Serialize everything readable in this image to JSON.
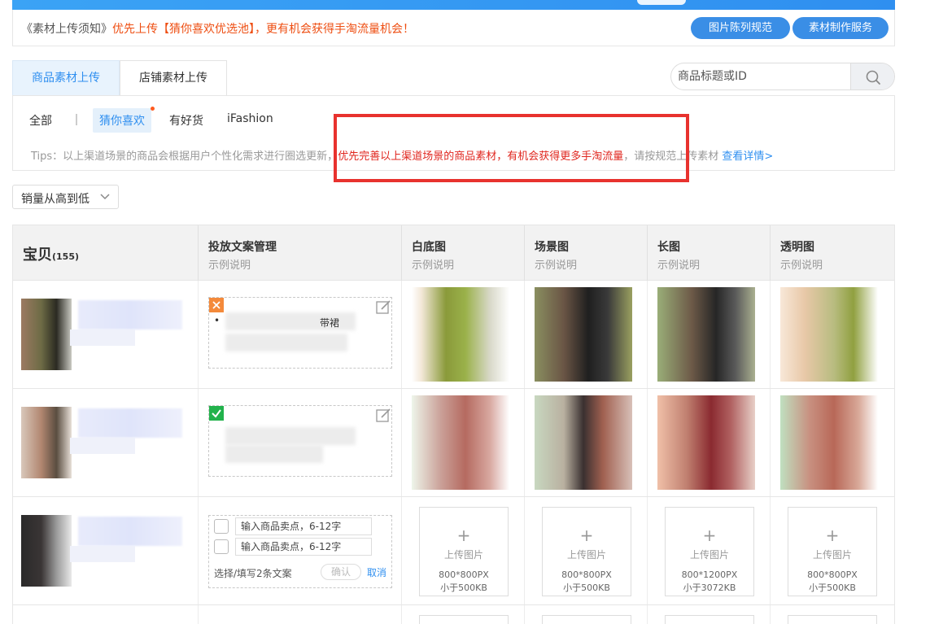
{
  "notice": {
    "prefix": "《素材上传须知》",
    "highlight": "优先上传【猜你喜欢优选池】，更有机会获得手淘流量机会！",
    "btn_spec": "图片陈列规范",
    "btn_service": "素材制作服务"
  },
  "tabs": [
    {
      "label": "商品素材上传",
      "active": true
    },
    {
      "label": "店铺素材上传",
      "active": false
    }
  ],
  "search": {
    "placeholder": "商品标题或ID"
  },
  "filters": {
    "all": "全部",
    "guess": "猜你喜欢",
    "good": "有好货",
    "ifashion": "iFashion"
  },
  "tips": {
    "prefix": "Tips：以上渠道场景的商品会根据用户个性化需求进行圈选更新，",
    "red": "优先完善以上渠道场景的商品素材，有机会获得更多手淘流量",
    "suffix": "，请按规范上传素材 ",
    "link": "查看详情>"
  },
  "sort": {
    "label": "销量从高到低"
  },
  "table": {
    "headers": [
      {
        "title": "宝贝",
        "count": "(155)"
      },
      {
        "title": "投放文案管理",
        "sub": "示例说明"
      },
      {
        "title": "白底图",
        "sub": "示例说明"
      },
      {
        "title": "场景图",
        "sub": "示例说明"
      },
      {
        "title": "长图",
        "sub": "示例说明"
      },
      {
        "title": "透明图",
        "sub": "示例说明"
      }
    ],
    "row1": {
      "copy_text": "带裙"
    },
    "row3": {
      "input1": "输入商品卖点，6-12字",
      "input2": "输入商品卖点，6-12字",
      "hint": "选择/填写2条文案",
      "confirm": "确认",
      "cancel": "取消",
      "uploads": [
        {
          "label": "上传图片",
          "size": "800*800PX",
          "limit": "小于500KB"
        },
        {
          "label": "上传图片",
          "size": "800*800PX",
          "limit": "小于500KB"
        },
        {
          "label": "上传图片",
          "size": "800*1200PX",
          "limit": "小于3072KB"
        },
        {
          "label": "上传图片",
          "size": "800*800PX",
          "limit": "小于500KB"
        }
      ]
    }
  },
  "colors": {
    "accent": "#2f8ff0",
    "orange": "#ee4e12",
    "red": "#e0271f",
    "highlight_box": "#e8322e"
  }
}
